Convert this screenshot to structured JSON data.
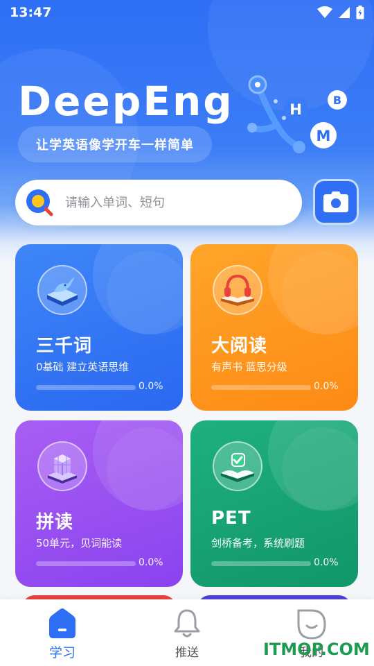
{
  "status_bar": {
    "time": "13:47"
  },
  "header": {
    "logo": "DeepEng",
    "slogan": "让学英语像学开车一样简单",
    "molecule_letters": [
      "H",
      "B",
      "M"
    ]
  },
  "search": {
    "placeholder": "请输入单词、短句",
    "value": ""
  },
  "cards": [
    {
      "title": "三千词",
      "subtitle": "0基础 建立英语思维",
      "progress": "0.0%",
      "progress_value": 0,
      "icon": "whale-book-icon",
      "color": "#2f73f6"
    },
    {
      "title": "大阅读",
      "subtitle": "有声书 蓝思分级",
      "progress": "0.0%",
      "progress_value": 0,
      "icon": "headphones-book-icon",
      "color": "#fe961e"
    },
    {
      "title": "拼读",
      "subtitle": "50单元，见词能读",
      "progress": "0.0%",
      "progress_value": 0,
      "icon": "cube-book-icon",
      "color": "#9a4ff1"
    },
    {
      "title": "PET",
      "subtitle": "剑桥备考，系统刷题",
      "progress": "0.0%",
      "progress_value": 0,
      "icon": "check-book-icon",
      "color": "#17a375"
    }
  ],
  "tabs": [
    {
      "label": "学习",
      "icon": "home-icon",
      "active": true
    },
    {
      "label": "推送",
      "icon": "bell-icon",
      "active": false
    },
    {
      "label": "我的",
      "icon": "profile-icon",
      "active": false
    }
  ],
  "watermark": "ITMOP.COM",
  "colors": {
    "primary": "#2f6ff5",
    "watermark": "#1d9b50"
  }
}
